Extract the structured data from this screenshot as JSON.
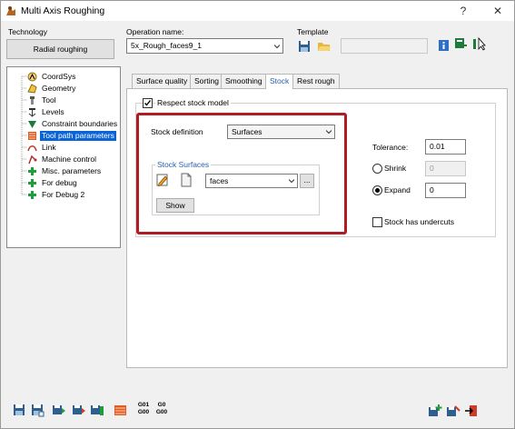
{
  "window": {
    "title": "Multi Axis Roughing",
    "help_glyph": "?",
    "close_glyph": "✕"
  },
  "technology": {
    "label": "Technology",
    "value": "Radial roughing"
  },
  "operation": {
    "label": "Operation name:",
    "value": "5x_Rough_faces9_1"
  },
  "template": {
    "label": "Template"
  },
  "tree": {
    "items": [
      {
        "label": "CoordSys",
        "icon": "coordsys-icon"
      },
      {
        "label": "Geometry",
        "icon": "geometry-icon"
      },
      {
        "label": "Tool",
        "icon": "tool-icon"
      },
      {
        "label": "Levels",
        "icon": "levels-icon"
      },
      {
        "label": "Constraint boundaries",
        "icon": "constraint-icon"
      },
      {
        "label": "Tool path parameters",
        "icon": "toolpath-icon",
        "selected": true
      },
      {
        "label": "Link",
        "icon": "link-icon"
      },
      {
        "label": "Machine control",
        "icon": "machine-icon"
      },
      {
        "label": "Misc. parameters",
        "icon": "plus-icon"
      },
      {
        "label": "For debug",
        "icon": "plus-icon"
      },
      {
        "label": "For Debug 2",
        "icon": "plus-icon"
      }
    ]
  },
  "tabs": [
    {
      "label": "Surface quality"
    },
    {
      "label": "Sorting"
    },
    {
      "label": "Smoothing"
    },
    {
      "label": "Stock",
      "active": true
    },
    {
      "label": "Rest rough"
    }
  ],
  "stock": {
    "respect_label": "Respect stock model",
    "respect_checked": true,
    "definition_label": "Stock definition",
    "definition_value": "Surfaces",
    "surfaces_group_label": "Stock Surfaces",
    "surfaces_value": "faces",
    "browse_label": "...",
    "show_label": "Show",
    "tolerance_label": "Tolerance:",
    "tolerance_value": "0.01",
    "shrink_label": "Shrink",
    "shrink_value": "0",
    "expand_label": "Expand",
    "expand_value": "0",
    "expand_selected": true,
    "undercuts_label": "Stock has undercuts",
    "undercuts_checked": false
  },
  "bottom": {
    "g01_top": "G01",
    "g01_bottom": "G00",
    "g00_top": "G0",
    "g00_bottom": "G00"
  },
  "colors": {
    "highlight": "#b01c23",
    "selection": "#0a64d8",
    "group_title": "#2a5fb0"
  }
}
